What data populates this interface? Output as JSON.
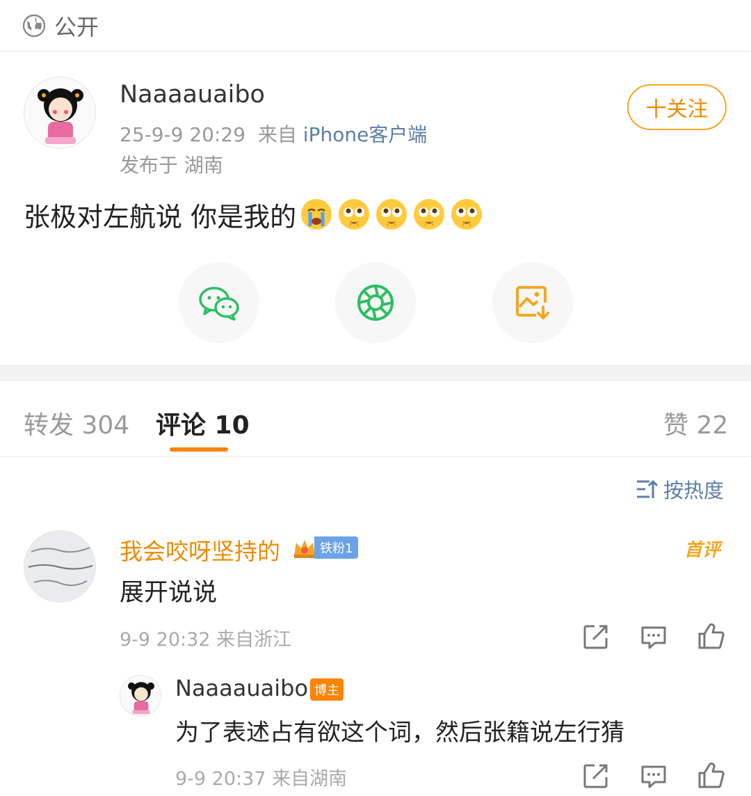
{
  "visibility": {
    "label": "公开",
    "icon": "globe-icon"
  },
  "post": {
    "author": "Naaaauaibo",
    "time": "25-9-9 20:29",
    "source_prefix": "来自",
    "device": "iPhone客户端",
    "location": "发布于 湖南",
    "follow_label": "十关注",
    "text": "张极对左航说 你是我的",
    "emojis": [
      "crying-emoji",
      "shy-emoji",
      "shy-emoji",
      "shy-emoji",
      "shy-emoji"
    ]
  },
  "share": [
    {
      "name": "wechat-icon",
      "color": "#2bbf60"
    },
    {
      "name": "moments-icon",
      "color": "#2bbf60"
    },
    {
      "name": "save-image-icon",
      "color": "#f5a623"
    }
  ],
  "tabs": {
    "repost": "转发 304",
    "comments": "评论 10",
    "likes": "赞 22"
  },
  "sort_label": "按热度",
  "comment": {
    "user": "我会咬呀坚持的",
    "fan_badge": "铁粉1",
    "first_label": "首评",
    "text": "展开说说",
    "meta": "9-9 20:32  来自浙江"
  },
  "reply": {
    "user": "Naaaauaibo",
    "owner_badge": "博主",
    "text": "为了表述占有欲这个词，然后张籍说左行猜",
    "meta": "9-9 20:37  来自湖南"
  },
  "colors": {
    "accent": "#ff8200",
    "link": "#5b7ea8",
    "username": "#f08a00"
  }
}
